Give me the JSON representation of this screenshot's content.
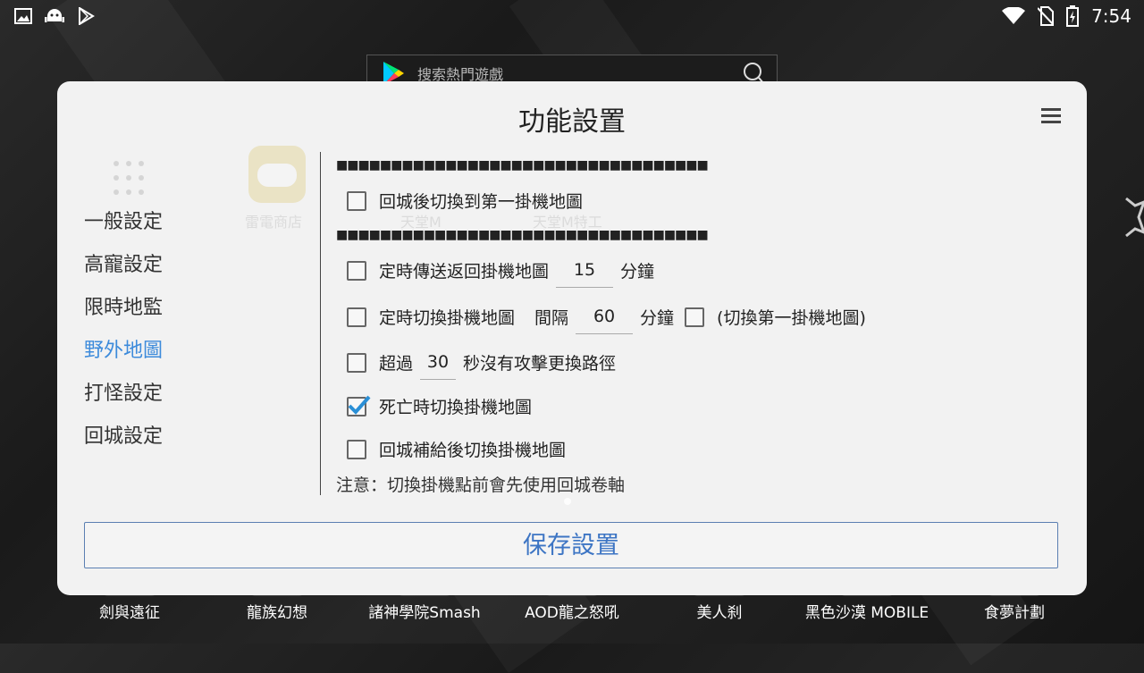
{
  "status_bar": {
    "time": "7:54",
    "left_icons": [
      "image-icon",
      "android-icon",
      "play-store-icon"
    ],
    "right_icons": [
      "wifi-icon",
      "no-sim-icon",
      "battery-charging-icon"
    ]
  },
  "search": {
    "placeholder": "搜索熱門遊戲"
  },
  "background_apps": {
    "labels": [
      "劍與遠征",
      "龍族幻想",
      "諸神學院Smash",
      "AOD龍之怒吼",
      "美人刹",
      "黑色沙漠 MOBILE",
      "食夢計劃"
    ]
  },
  "ghost_labels": [
    "雷電商店",
    "天堂M",
    "天堂M特工"
  ],
  "dialog": {
    "title": "功能設置",
    "nav": [
      {
        "label": "一般設定",
        "active": false
      },
      {
        "label": "高寵設定",
        "active": false
      },
      {
        "label": "限時地監",
        "active": false
      },
      {
        "label": "野外地圖",
        "active": true
      },
      {
        "label": "打怪設定",
        "active": false
      },
      {
        "label": "回城設定",
        "active": false
      }
    ],
    "section_bar_1": "■■■■■■■■■■■■■■■■■■■■■■■■■■■■■■■■■■",
    "section_bar_2": "■■■■■■■■■■■■■■■■■■■■■■■■■■■■■■■■■■",
    "options": {
      "return_switch_first": {
        "label": "回城後切換到第一掛機地圖",
        "checked": false
      },
      "timed_teleport": {
        "label": "定時傳送返回掛機地圖",
        "value": "15",
        "unit": "分鐘",
        "checked": false
      },
      "timed_switch": {
        "label": "定時切換掛機地圖",
        "interval_label": "間隔",
        "value": "60",
        "unit": "分鐘",
        "checked": false,
        "sub_label": "(切換第一掛機地圖)",
        "sub_checked": false
      },
      "no_attack": {
        "prefix": "超過",
        "value": "30",
        "suffix": "秒沒有攻擊更換路徑",
        "checked": false
      },
      "death_switch": {
        "label": "死亡時切換掛機地圖",
        "checked": true
      },
      "resupply_switch": {
        "label": "回城補給後切換掛機地圖",
        "checked": false
      }
    },
    "note": "注意：切換掛機點前會先使用回城卷軸",
    "save_label": "保存設置"
  },
  "colors": {
    "accent": "#3d8bdb",
    "check": "#2a8fd6"
  }
}
